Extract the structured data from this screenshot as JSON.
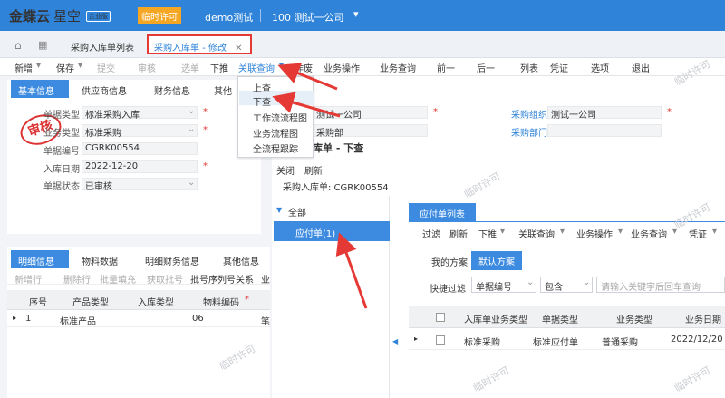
{
  "app": {
    "logo": "金蝶云",
    "logo_sub": "星空",
    "edition": "企业版",
    "license": "临时许可",
    "demo": "demo测试",
    "org": "100 测试一公司"
  },
  "tabs": {
    "list_tab": "采购入库单列表",
    "active_tab": "采购入库单 - 修改"
  },
  "menu": [
    "新增",
    "保存",
    "提交",
    "审核",
    "选单",
    "下推",
    "关联查询",
    "作废",
    "业务操作",
    "业务查询",
    "前一",
    "后一",
    "列表",
    "凭证",
    "选项",
    "退出"
  ],
  "dropdown": [
    "上查",
    "下查",
    "工作流流程图",
    "业务流程图",
    "全流程跟踪"
  ],
  "header": {
    "tabs": [
      "基本信息",
      "供应商信息",
      "财务信息",
      "其他"
    ],
    "stamp": "审核",
    "fields": [
      {
        "label": "单据类型",
        "value": "标准采购入库"
      },
      {
        "label": "业务类型",
        "value": "标准采购"
      },
      {
        "label": "单据编号",
        "value": "CGRK00554"
      },
      {
        "label": "入库日期",
        "value": "2022-12-20"
      },
      {
        "label": "单据状态",
        "value": "已审核"
      }
    ],
    "right_fields": [
      {
        "label": "",
        "value": "测试一公司"
      },
      {
        "label": "采购组织",
        "value": "测试一公司"
      },
      {
        "label": "",
        "value": "采购部"
      },
      {
        "label": "采购部门",
        "value": ""
      }
    ]
  },
  "detail": {
    "tabs": [
      "明细信息",
      "物料数据",
      "明细财务信息",
      "其他信息"
    ],
    "toolbar": [
      "新增行",
      "删除行",
      "批量填充",
      "获取批号",
      "批号序列号关系",
      "业"
    ],
    "columns": [
      "序号",
      "产品类型",
      "入库类型",
      "物料编码"
    ],
    "rows": [
      {
        "seq": "1",
        "type": "标准产品",
        "intype": "",
        "code": "06",
        "extra": "笔"
      }
    ]
  },
  "dialog": {
    "title": "入库单 - 下查",
    "toolbar": [
      "关闭",
      "刷新"
    ],
    "subtitle": "采购入库单: CGRK00554",
    "tree_all": "全部",
    "tree_selected": "应付单(1)",
    "list_tab": "应付单列表",
    "list_toolbar": [
      "过滤",
      "刷新",
      "下推",
      "关联查询",
      "业务操作",
      "业务查询",
      "凭证"
    ],
    "scheme_label": "我的方案",
    "scheme_default": "默认方案",
    "filter_label": "快捷过滤",
    "filter_field": "单据编号",
    "filter_op": "包含",
    "filter_placeholder": "请输入关键字后回车查询",
    "columns": [
      "入库单业务类型",
      "单据类型",
      "业务类型",
      "业务日期"
    ],
    "rows": [
      {
        "c1": "标准采购",
        "c2": "标准应付单",
        "c3": "普通采购",
        "c4": "2022/12/20"
      }
    ]
  },
  "watermark": "临时许可"
}
